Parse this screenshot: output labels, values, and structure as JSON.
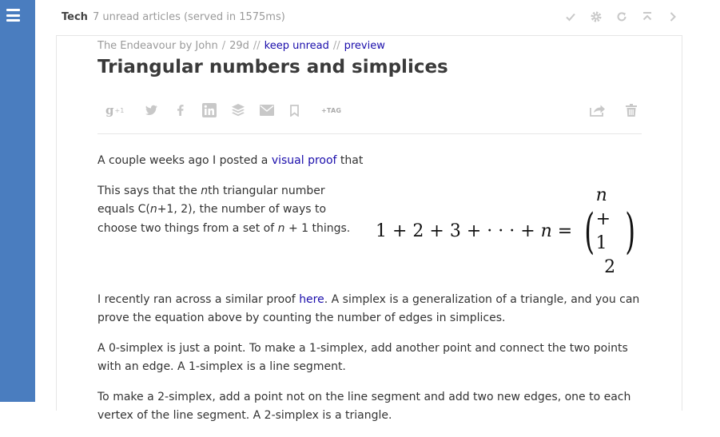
{
  "topbar": {
    "feed_title": "Tech",
    "status": "7 unread articles (served in 1575ms)"
  },
  "article": {
    "feed_name": "The Endeavour by John",
    "age": "29d",
    "keep_unread": "keep unread",
    "preview": "preview",
    "title": "Triangular numbers and simplices",
    "share": {
      "gplus_label": "g",
      "gplus_count": "+1",
      "tag_label": "+TAG"
    },
    "paragraphs": {
      "p1_text": "A couple weeks ago I posted a ",
      "p1_link": "visual proof",
      "p1_after": " that",
      "p2_a": "This says that the ",
      "p2_n": "n",
      "p2_b": "th triangular number equals C(",
      "p2_n2": "n",
      "p2_c": "+1, 2), the number of ways to choose two things from a set of ",
      "p2_n3": "n",
      "p2_d": " + 1 things.",
      "p3_a": "I recently ran across a similar proof ",
      "p3_link": "here",
      "p3_b": ". A simplex is a generalization of a triangle, and you can prove the equation above by counting the number of edges in simplices.",
      "p4": "A 0-simplex is just a point. To make a 1-simplex, add another point and connect the two points with an edge. A 1-simplex is a line segment.",
      "p5": "To make a 2-simplex, add a point not on the line segment and add two new edges, one to each vertex of the line segment. A 2-simplex is a triangle."
    },
    "formula": {
      "lhs_prefix": "1 + 2 + 3 + · · · + ",
      "lhs_var": "n",
      "equals": " =",
      "top_var": "n",
      "top_rest": " + 1",
      "bottom": "2"
    }
  }
}
